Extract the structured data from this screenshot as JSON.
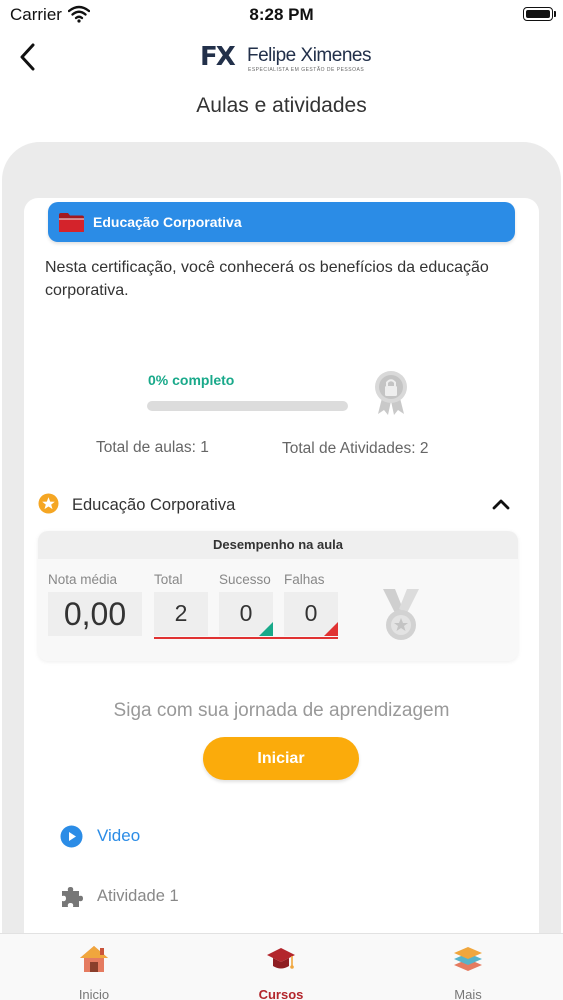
{
  "status_bar": {
    "carrier": "Carrier",
    "time": "8:28 PM",
    "icons": [
      "wifi-icon",
      "battery-icon"
    ]
  },
  "header": {
    "back_icon": "chevron-left-icon",
    "logo": {
      "mark": "FX",
      "name": "Felipe Ximenes",
      "tagline": "ESPECIALISTA EM GESTÃO DE PESSOAS"
    },
    "title": "Aulas e atividades"
  },
  "course": {
    "icon": "folder-icon",
    "title": "Educação Corporativa",
    "description": "Nesta certificação, você conhecerá os benefícios da educação corporativa.",
    "progress_label": "0% completo",
    "progress_value": 0,
    "certificate_icon": "certificate-badge-icon",
    "total_aulas": "Total de aulas: 1",
    "total_atividades": "Total de Atividades: 2"
  },
  "lesson": {
    "icon": "star-icon",
    "title": "Educação Corporativa",
    "toggle_icon": "chevron-up-icon",
    "performance": {
      "heading": "Desempenho na aula",
      "stats": {
        "nota_label": "Nota média",
        "nota_value": "0,00",
        "total_label": "Total",
        "total_value": "2",
        "sucesso_label": "Sucesso",
        "sucesso_value": "0",
        "falhas_label": "Falhas",
        "falhas_value": "0"
      },
      "medal_icon": "medal-icon"
    }
  },
  "journey": {
    "message": "Siga com sua jornada de aprendizagem",
    "button_label": "Iniciar"
  },
  "activities": [
    {
      "label": "Video",
      "icon": "play-circle-icon",
      "color": "#2b8ce6"
    },
    {
      "label": "Atividade 1",
      "icon": "puzzle-icon",
      "color": "#888888"
    }
  ],
  "tab_bar": {
    "tabs": [
      {
        "label": "Inicio",
        "icon": "home-icon",
        "active": false
      },
      {
        "label": "Cursos",
        "icon": "graduation-cap-icon",
        "active": true
      },
      {
        "label": "Mais",
        "icon": "layers-icon",
        "active": false
      }
    ]
  },
  "colors": {
    "primary_blue": "#2b8ce6",
    "accent_orange": "#fbab0b",
    "success_green": "#19a98a",
    "danger_red": "#e03232",
    "brand_red": "#b3262c"
  }
}
